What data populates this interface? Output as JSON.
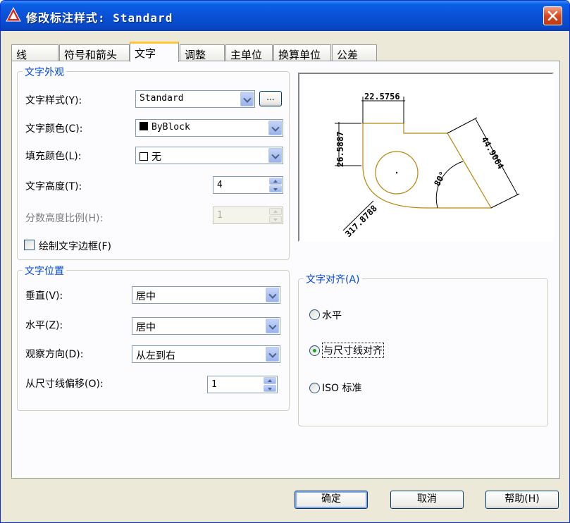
{
  "window": {
    "title": "修改标注样式: Standard"
  },
  "tabs": [
    {
      "label": "线"
    },
    {
      "label": "符号和箭头"
    },
    {
      "label": "文字"
    },
    {
      "label": "调整"
    },
    {
      "label": "主单位"
    },
    {
      "label": "换算单位"
    },
    {
      "label": "公差"
    }
  ],
  "text_appearance": {
    "title": "文字外观",
    "style_label": "文字样式(Y):",
    "style_value": "Standard",
    "ellipsis_label": "...",
    "color_label": "文字颜色(C):",
    "color_value": "ByBlock",
    "fill_label": "填充颜色(L):",
    "fill_value": "无",
    "height_label": "文字高度(T):",
    "height_value": "4",
    "fraction_label": "分数高度比例(H):",
    "fraction_value": "1",
    "frame_label": "绘制文字边框(F)"
  },
  "text_placement": {
    "title": "文字位置",
    "vertical_label": "垂直(V):",
    "vertical_value": "居中",
    "horizontal_label": "水平(Z):",
    "horizontal_value": "居中",
    "view_label": "观察方向(D):",
    "view_value": "从左到右",
    "offset_label": "从尺寸线偏移(O):",
    "offset_value": "1"
  },
  "text_alignment": {
    "title": "文字对齐(A)",
    "options": [
      {
        "label": "水平",
        "selected": false
      },
      {
        "label": "与尺寸线对齐",
        "selected": true
      },
      {
        "label": "ISO 标准",
        "selected": false
      }
    ]
  },
  "preview": {
    "dim_top": "22.5756",
    "dim_left": "26.5887",
    "dim_right": "44.9064",
    "dim_angle": "80°",
    "dim_radius": "317.8788",
    "geometry_color": "#b8860b"
  },
  "buttons": {
    "ok": "确定",
    "cancel": "取消",
    "help": "帮助(H)"
  },
  "colors": {
    "titlebar": "#0a52d8",
    "group_title": "#0046d5",
    "close": "#d8481f"
  }
}
